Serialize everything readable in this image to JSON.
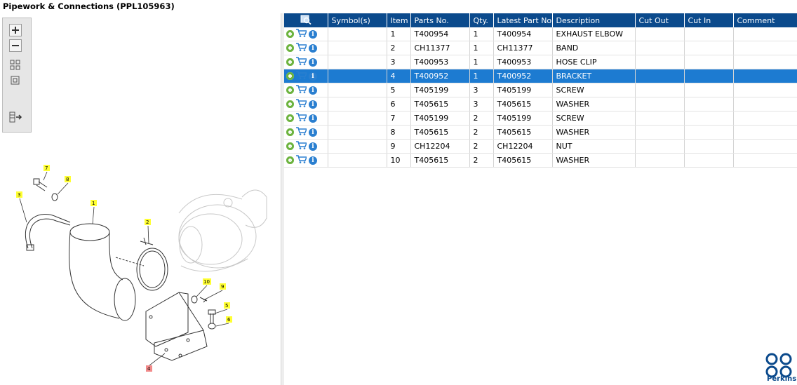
{
  "window": {
    "title": "Pipework & Connections (PPL105963)"
  },
  "toolbar": {
    "zoom_in": "zoom-in-icon",
    "zoom_out": "zoom-out-icon",
    "fit_all": "fit-all-icon",
    "fit_page": "fit-page-icon",
    "export": "export-list-icon"
  },
  "diagram": {
    "callouts": [
      "7",
      "8",
      "3",
      "1",
      "2",
      "10",
      "9",
      "5",
      "6",
      "4"
    ]
  },
  "table": {
    "columns": [
      "Symbol(s)",
      "Item",
      "Parts No.",
      "Qty.",
      "Latest Part No.",
      "Description",
      "Cut Out",
      "Cut In",
      "Comment"
    ],
    "rows": [
      {
        "item": "1",
        "part_no": "T400954",
        "qty": "1",
        "latest": "T400954",
        "description": "EXHAUST ELBOW"
      },
      {
        "item": "2",
        "part_no": "CH11377",
        "qty": "1",
        "latest": "CH11377",
        "description": "BAND"
      },
      {
        "item": "3",
        "part_no": "T400953",
        "qty": "1",
        "latest": "T400953",
        "description": "HOSE CLIP"
      },
      {
        "item": "4",
        "part_no": "T400952",
        "qty": "1",
        "latest": "T400952",
        "description": "BRACKET"
      },
      {
        "item": "5",
        "part_no": "T405199",
        "qty": "3",
        "latest": "T405199",
        "description": "SCREW"
      },
      {
        "item": "6",
        "part_no": "T405615",
        "qty": "3",
        "latest": "T405615",
        "description": "WASHER"
      },
      {
        "item": "7",
        "part_no": "T405199",
        "qty": "2",
        "latest": "T405199",
        "description": "SCREW"
      },
      {
        "item": "8",
        "part_no": "T405615",
        "qty": "2",
        "latest": "T405615",
        "description": "WASHER"
      },
      {
        "item": "9",
        "part_no": "CH12204",
        "qty": "2",
        "latest": "CH12204",
        "description": "NUT"
      },
      {
        "item": "10",
        "part_no": "T405615",
        "qty": "2",
        "latest": "T405615",
        "description": "WASHER"
      }
    ],
    "selected_item": "4"
  },
  "brand": {
    "name": "Perkins",
    "color": "#0b4a8c"
  },
  "colors": {
    "header": "#0b4a8c",
    "selected": "#1d7bd1",
    "callout": "#ffff33",
    "callout_selected": "#f28a8a"
  }
}
